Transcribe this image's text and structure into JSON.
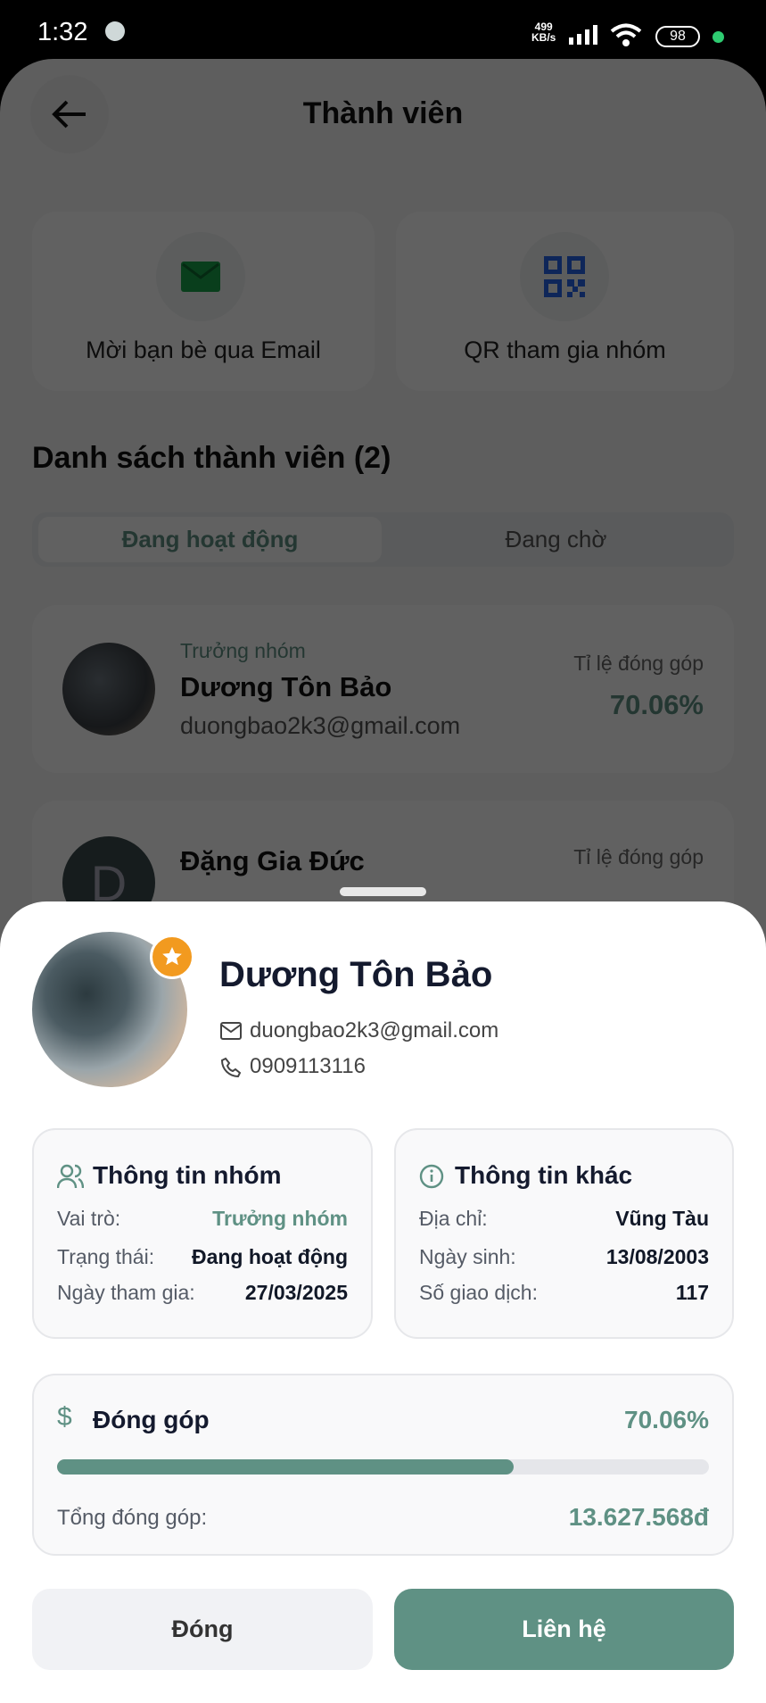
{
  "status_bar": {
    "time": "1:32",
    "net_speed_value": "499",
    "net_speed_unit": "KB/s",
    "battery": "98"
  },
  "header": {
    "title": "Thành viên"
  },
  "actions": [
    {
      "label": "Mời bạn bè qua Email",
      "icon": "mail-icon"
    },
    {
      "label": "QR tham gia nhóm",
      "icon": "qr-code-icon"
    }
  ],
  "members_section": {
    "title": "Danh sách thành viên (2)",
    "tabs": [
      "Đang hoạt động",
      "Đang chờ"
    ]
  },
  "members": [
    {
      "role": "Trưởng nhóm",
      "name": "Dương Tôn Bảo",
      "email": "duongbao2k3@gmail.com",
      "rate_label": "Tỉ lệ đóng góp",
      "rate": "70.06%"
    },
    {
      "name": "Đặng Gia Đức",
      "initial": "D",
      "rate_label": "Tỉ lệ đóng góp"
    }
  ],
  "sheet": {
    "name": "Dương Tôn Bảo",
    "email": "duongbao2k3@gmail.com",
    "phone": "0909113116",
    "group_info": {
      "title": "Thông tin nhóm",
      "rows": [
        {
          "label": "Vai trò:",
          "value": "Trưởng nhóm"
        },
        {
          "label": "Trạng thái:",
          "value": "Đang hoạt động"
        },
        {
          "label": "Ngày tham gia:",
          "value": "27/03/2025"
        }
      ]
    },
    "other_info": {
      "title": "Thông tin khác",
      "rows": [
        {
          "label": "Địa chỉ:",
          "value": "Vũng Tàu"
        },
        {
          "label": "Ngày sinh:",
          "value": "13/08/2003"
        },
        {
          "label": "Số giao dịch:",
          "value": "117"
        }
      ]
    },
    "contribution": {
      "title": "Đóng góp",
      "percent_label": "70.06%",
      "percent": 70.06,
      "total_label": "Tổng đóng góp:",
      "total": "13.627.568đ"
    },
    "buttons": {
      "close": "Đóng",
      "contact": "Liên hệ"
    }
  },
  "colors": {
    "accent": "#5f9184",
    "star": "#f29a1f"
  }
}
